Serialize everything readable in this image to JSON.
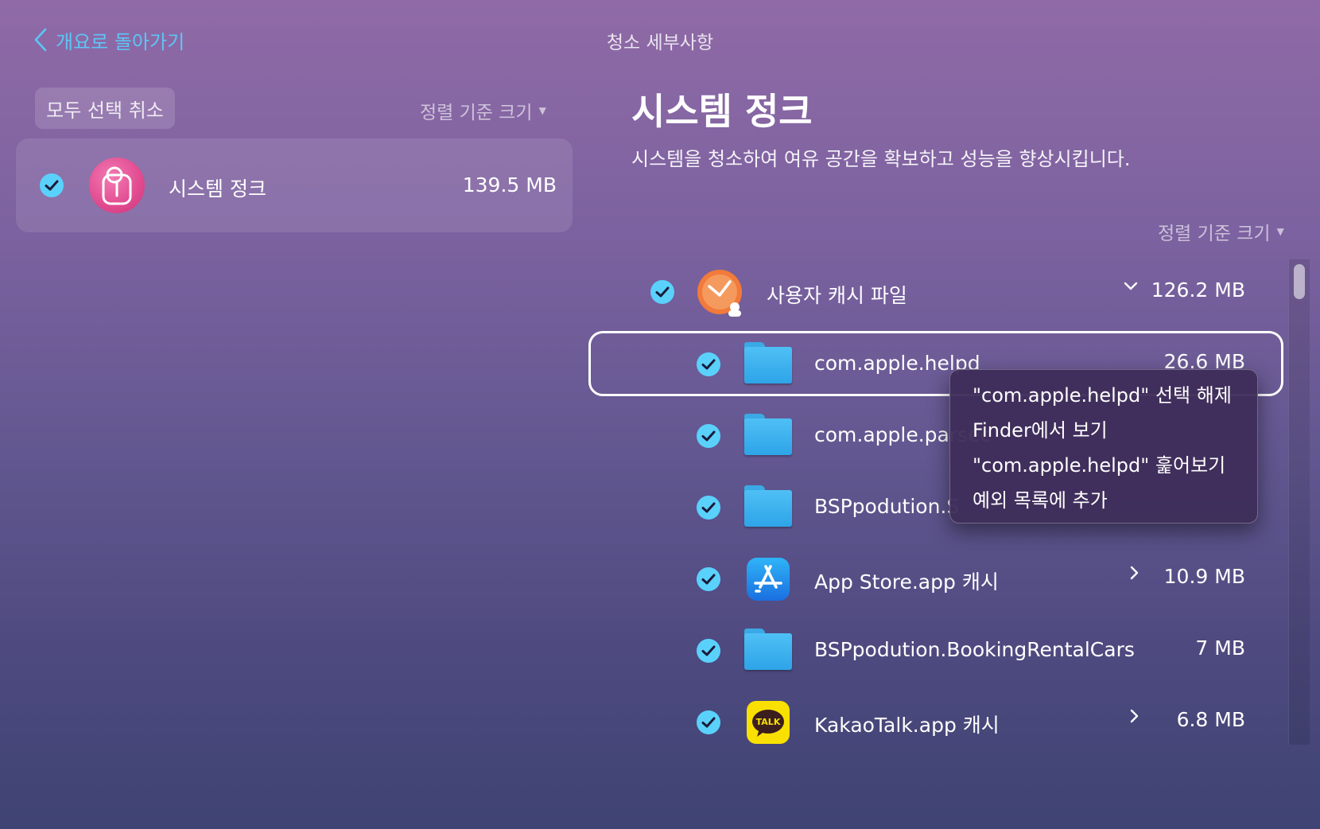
{
  "header": {
    "back_label": "개요로 돌아가기",
    "title": "청소 세부사항"
  },
  "left_pane": {
    "deselect_all_label": "모두 선택 취소",
    "sort_label": "정렬 기준 크기",
    "category": {
      "label": "시스템 정크",
      "size": "139.5 MB",
      "icon": "trash-bin-icon"
    }
  },
  "right_pane": {
    "title": "시스템 정크",
    "description": "시스템을 청소하여 여유 공간을 확보하고 성능을 향상시킵니다.",
    "sort_label": "정렬 기준 크기",
    "items": [
      {
        "label": "사용자 캐시 파일",
        "size": "126.2 MB",
        "icon": "user-cache-icon",
        "expanded": true
      },
      {
        "label": "com.apple.helpd",
        "size": "26.6 MB",
        "icon": "folder-icon"
      },
      {
        "label": "com.apple.parsec",
        "size": "",
        "icon": "folder-icon"
      },
      {
        "label": "BSPpodution.S",
        "size": "",
        "icon": "folder-icon"
      },
      {
        "label": "App Store.app 캐시",
        "size": "10.9 MB",
        "icon": "app-store-icon"
      },
      {
        "label": "BSPpodution.BookingRentalCars",
        "size": "7 MB",
        "icon": "folder-icon"
      },
      {
        "label": "KakaoTalk.app 캐시",
        "size": "6.8 MB",
        "icon": "kakaotalk-icon"
      }
    ],
    "talk_badge": "TALK"
  },
  "context_menu": {
    "items": [
      "\"com.apple.helpd\" 선택 해제",
      "Finder에서 보기",
      "\"com.apple.helpd\" 훑어보기",
      "예외 목록에 추가"
    ]
  },
  "colors": {
    "accent": "#5ad1fb",
    "folder": "#3aa9e6",
    "category_icon": "#e14a8f",
    "user_cache_icon": "#f27a3a",
    "kakao": "#f9e000"
  }
}
